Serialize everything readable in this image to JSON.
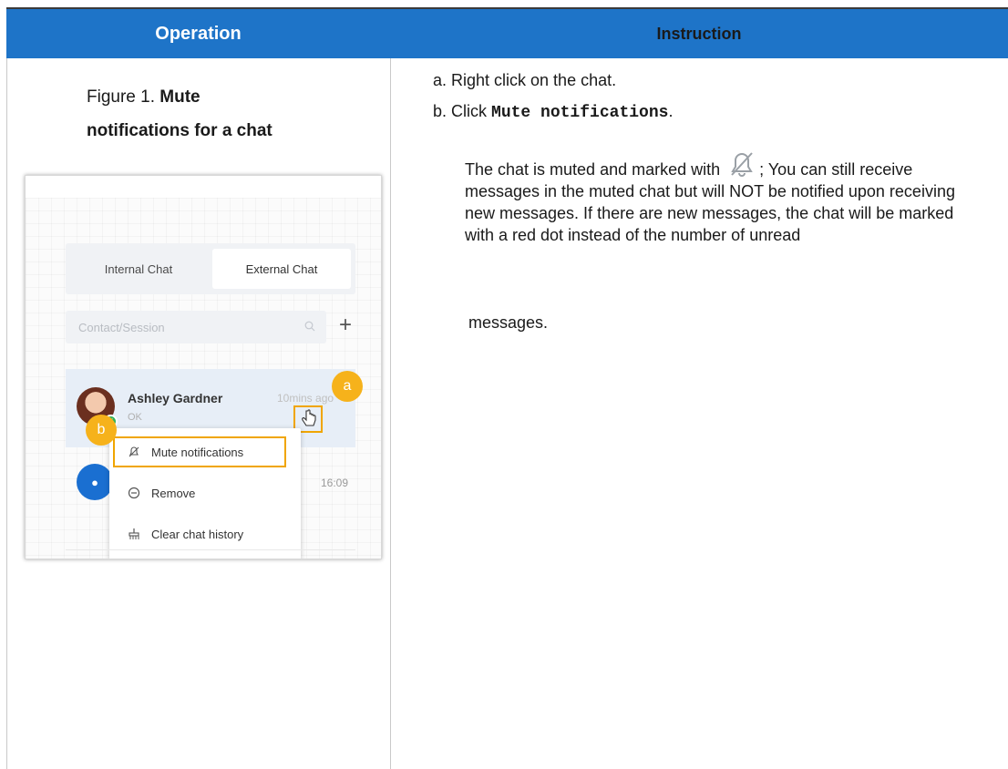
{
  "header": {
    "operation": "Operation",
    "instruction": "Instruction"
  },
  "caption": {
    "prefix": "Figure 1.",
    "bold_part1": "Mute",
    "bold_part2": "notifications for a chat"
  },
  "screenshot": {
    "tabs": [
      "Internal Chat",
      "External Chat"
    ],
    "search_placeholder": "Contact/Session",
    "chat": {
      "name": "Ashley Gardner",
      "subtitle": "OK",
      "time": "10mins ago"
    },
    "row2_time": "16:09",
    "badge_a": "a",
    "badge_b": "b",
    "menu": [
      "Mute notifications",
      "Remove",
      "Clear chat history"
    ]
  },
  "instructions": {
    "step_a": "a. Right click on the chat.",
    "step_b_prefix": "b. Click ",
    "step_b_code": "Mute notifications",
    "step_b_suffix": ".",
    "result_before_icon": "The chat is muted and marked with",
    "result_after_icon": "; You can still receive messages in the muted chat but will NOT be notified upon receiving new messages. If there are new messages, the chat will be marked with a red dot instead of the number of unread",
    "result_last": "messages."
  },
  "colors": {
    "header_bg": "#1e74c8",
    "highlight": "#f0a500",
    "badge": "#f6b21b"
  }
}
